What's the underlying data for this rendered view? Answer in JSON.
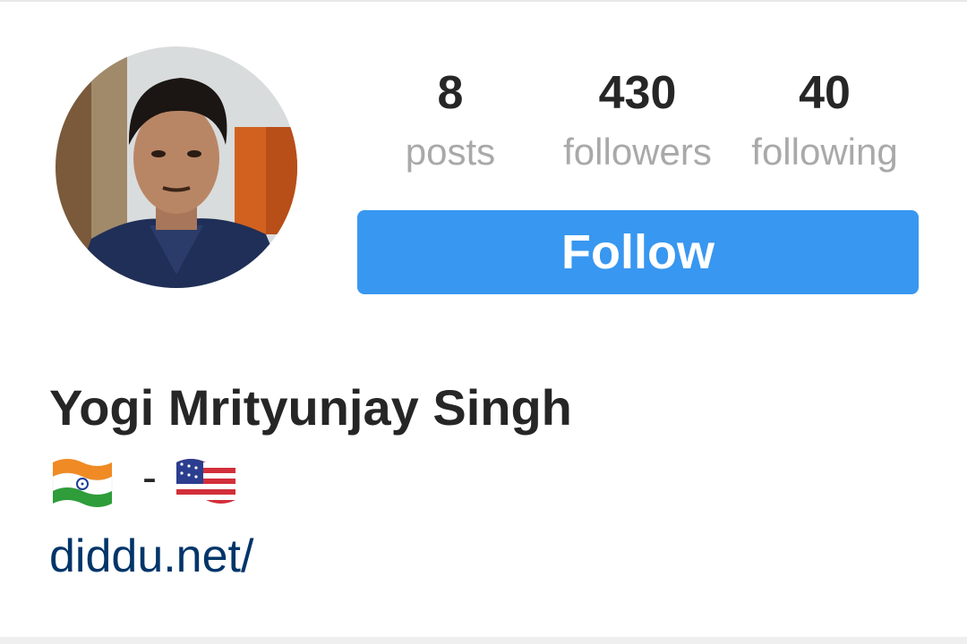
{
  "profile": {
    "name": "Yogi Mrityunjay Singh",
    "bio_separator": "-",
    "bio_flags": [
      "india-flag-icon",
      "us-flag-icon"
    ],
    "website": "diddu.net/"
  },
  "stats": [
    {
      "count": "8",
      "label": "posts"
    },
    {
      "count": "430",
      "label": "followers"
    },
    {
      "count": "40",
      "label": "following"
    }
  ],
  "actions": {
    "follow_label": "Follow"
  },
  "colors": {
    "follow_button": "#3897f0",
    "link": "#003569",
    "text": "#262626",
    "secondary_text": "#a9a9a9"
  }
}
